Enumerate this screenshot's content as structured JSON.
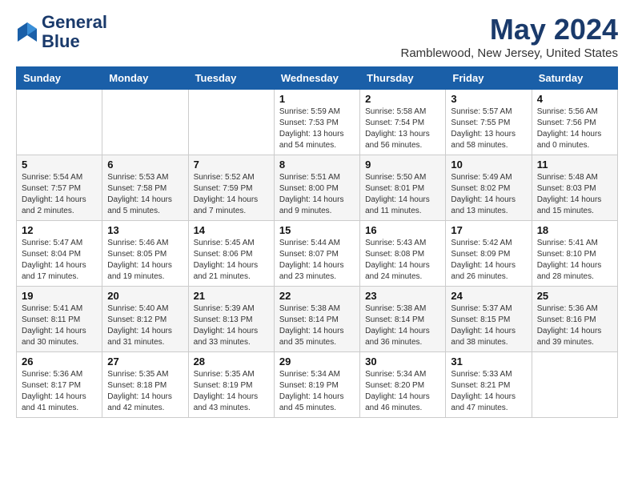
{
  "header": {
    "logo_line1": "General",
    "logo_line2": "Blue",
    "month": "May 2024",
    "location": "Ramblewood, New Jersey, United States"
  },
  "weekdays": [
    "Sunday",
    "Monday",
    "Tuesday",
    "Wednesday",
    "Thursday",
    "Friday",
    "Saturday"
  ],
  "weeks": [
    [
      {
        "day": "",
        "info": ""
      },
      {
        "day": "",
        "info": ""
      },
      {
        "day": "",
        "info": ""
      },
      {
        "day": "1",
        "info": "Sunrise: 5:59 AM\nSunset: 7:53 PM\nDaylight: 13 hours\nand 54 minutes."
      },
      {
        "day": "2",
        "info": "Sunrise: 5:58 AM\nSunset: 7:54 PM\nDaylight: 13 hours\nand 56 minutes."
      },
      {
        "day": "3",
        "info": "Sunrise: 5:57 AM\nSunset: 7:55 PM\nDaylight: 13 hours\nand 58 minutes."
      },
      {
        "day": "4",
        "info": "Sunrise: 5:56 AM\nSunset: 7:56 PM\nDaylight: 14 hours\nand 0 minutes."
      }
    ],
    [
      {
        "day": "5",
        "info": "Sunrise: 5:54 AM\nSunset: 7:57 PM\nDaylight: 14 hours\nand 2 minutes."
      },
      {
        "day": "6",
        "info": "Sunrise: 5:53 AM\nSunset: 7:58 PM\nDaylight: 14 hours\nand 5 minutes."
      },
      {
        "day": "7",
        "info": "Sunrise: 5:52 AM\nSunset: 7:59 PM\nDaylight: 14 hours\nand 7 minutes."
      },
      {
        "day": "8",
        "info": "Sunrise: 5:51 AM\nSunset: 8:00 PM\nDaylight: 14 hours\nand 9 minutes."
      },
      {
        "day": "9",
        "info": "Sunrise: 5:50 AM\nSunset: 8:01 PM\nDaylight: 14 hours\nand 11 minutes."
      },
      {
        "day": "10",
        "info": "Sunrise: 5:49 AM\nSunset: 8:02 PM\nDaylight: 14 hours\nand 13 minutes."
      },
      {
        "day": "11",
        "info": "Sunrise: 5:48 AM\nSunset: 8:03 PM\nDaylight: 14 hours\nand 15 minutes."
      }
    ],
    [
      {
        "day": "12",
        "info": "Sunrise: 5:47 AM\nSunset: 8:04 PM\nDaylight: 14 hours\nand 17 minutes."
      },
      {
        "day": "13",
        "info": "Sunrise: 5:46 AM\nSunset: 8:05 PM\nDaylight: 14 hours\nand 19 minutes."
      },
      {
        "day": "14",
        "info": "Sunrise: 5:45 AM\nSunset: 8:06 PM\nDaylight: 14 hours\nand 21 minutes."
      },
      {
        "day": "15",
        "info": "Sunrise: 5:44 AM\nSunset: 8:07 PM\nDaylight: 14 hours\nand 23 minutes."
      },
      {
        "day": "16",
        "info": "Sunrise: 5:43 AM\nSunset: 8:08 PM\nDaylight: 14 hours\nand 24 minutes."
      },
      {
        "day": "17",
        "info": "Sunrise: 5:42 AM\nSunset: 8:09 PM\nDaylight: 14 hours\nand 26 minutes."
      },
      {
        "day": "18",
        "info": "Sunrise: 5:41 AM\nSunset: 8:10 PM\nDaylight: 14 hours\nand 28 minutes."
      }
    ],
    [
      {
        "day": "19",
        "info": "Sunrise: 5:41 AM\nSunset: 8:11 PM\nDaylight: 14 hours\nand 30 minutes."
      },
      {
        "day": "20",
        "info": "Sunrise: 5:40 AM\nSunset: 8:12 PM\nDaylight: 14 hours\nand 31 minutes."
      },
      {
        "day": "21",
        "info": "Sunrise: 5:39 AM\nSunset: 8:13 PM\nDaylight: 14 hours\nand 33 minutes."
      },
      {
        "day": "22",
        "info": "Sunrise: 5:38 AM\nSunset: 8:14 PM\nDaylight: 14 hours\nand 35 minutes."
      },
      {
        "day": "23",
        "info": "Sunrise: 5:38 AM\nSunset: 8:14 PM\nDaylight: 14 hours\nand 36 minutes."
      },
      {
        "day": "24",
        "info": "Sunrise: 5:37 AM\nSunset: 8:15 PM\nDaylight: 14 hours\nand 38 minutes."
      },
      {
        "day": "25",
        "info": "Sunrise: 5:36 AM\nSunset: 8:16 PM\nDaylight: 14 hours\nand 39 minutes."
      }
    ],
    [
      {
        "day": "26",
        "info": "Sunrise: 5:36 AM\nSunset: 8:17 PM\nDaylight: 14 hours\nand 41 minutes."
      },
      {
        "day": "27",
        "info": "Sunrise: 5:35 AM\nSunset: 8:18 PM\nDaylight: 14 hours\nand 42 minutes."
      },
      {
        "day": "28",
        "info": "Sunrise: 5:35 AM\nSunset: 8:19 PM\nDaylight: 14 hours\nand 43 minutes."
      },
      {
        "day": "29",
        "info": "Sunrise: 5:34 AM\nSunset: 8:19 PM\nDaylight: 14 hours\nand 45 minutes."
      },
      {
        "day": "30",
        "info": "Sunrise: 5:34 AM\nSunset: 8:20 PM\nDaylight: 14 hours\nand 46 minutes."
      },
      {
        "day": "31",
        "info": "Sunrise: 5:33 AM\nSunset: 8:21 PM\nDaylight: 14 hours\nand 47 minutes."
      },
      {
        "day": "",
        "info": ""
      }
    ]
  ]
}
